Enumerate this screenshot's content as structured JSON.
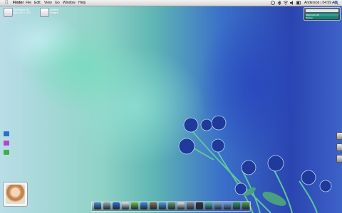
{
  "menubar": {
    "app_name": "Finder",
    "menus": [
      "File",
      "Edit",
      "View",
      "Go",
      "Window",
      "Help"
    ],
    "user_clock": "Anderson | 04:59 AM"
  },
  "desktop": {
    "icons": [
      {
        "label_line1": "Macintosh HD",
        "label_line2": "Mac OS X 10.5"
      },
      {
        "label_line1": "Untitled",
        "label_line2": "Images"
      }
    ]
  },
  "widget": {
    "row1": "Macintosh HD",
    "row2": "Backup"
  },
  "side_icons": [
    "finder-icon",
    "itunes-icon",
    "messages-icon"
  ],
  "dock": {
    "apps": [
      {
        "name": "finder-dock-icon",
        "color": "#4a8fd6"
      },
      {
        "name": "mail-dock-icon",
        "color": "#9aa7b2"
      },
      {
        "name": "safari-dock-icon",
        "color": "#2f6fd0"
      },
      {
        "name": "ical-dock-icon",
        "color": "#e2e2e2"
      },
      {
        "name": "itunes-dock-icon",
        "color": "#6bc04a"
      },
      {
        "name": "iphoto-dock-icon",
        "color": "#3a8fd8"
      },
      {
        "name": "imovie-dock-icon",
        "color": "#8b7050"
      },
      {
        "name": "preview-dock-icon",
        "color": "#4aa0e0"
      },
      {
        "name": "addressbook-dock-icon",
        "color": "#6a9a6a"
      },
      {
        "name": "textedit-dock-icon",
        "color": "#e8e4d8"
      },
      {
        "name": "system-prefs-dock-icon",
        "color": "#8c8c8c"
      },
      {
        "name": "terminal-dock-icon",
        "color": "#333"
      },
      {
        "name": "utilities-dock-icon",
        "color": "#4ab8a0"
      },
      {
        "name": "downloads-dock-icon",
        "color": "#7fa7d0"
      },
      {
        "name": "documents-dock-icon",
        "color": "#6ea6d8"
      },
      {
        "name": "applications-dock-icon",
        "color": "#2e9a5e"
      },
      {
        "name": "trash-dock-icon",
        "color": "#50a040"
      }
    ]
  }
}
